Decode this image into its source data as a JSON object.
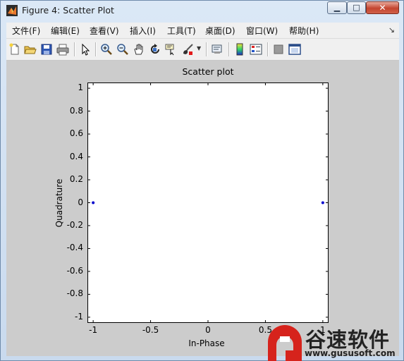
{
  "window": {
    "title": "Figure 4: Scatter Plot",
    "buttons": {
      "minimize": "▁",
      "maximize": "□",
      "close": "✕"
    }
  },
  "menu": {
    "items": [
      "文件(F)",
      "编辑(E)",
      "查看(V)",
      "插入(I)",
      "工具(T)",
      "桌面(D)",
      "窗口(W)",
      "帮助(H)"
    ],
    "overflow": "↘"
  },
  "toolbar": {
    "icons": [
      "new-icon",
      "open-icon",
      "save-icon",
      "print-icon",
      "pointer-icon",
      "zoom-in-icon",
      "zoom-out-icon",
      "pan-icon",
      "rotate-icon",
      "data-cursor-icon",
      "brush-icon",
      "link-icon",
      "colorbar-icon",
      "legend-icon",
      "hide-plot-tools-icon",
      "show-plot-tools-icon"
    ]
  },
  "chart_data": {
    "type": "scatter",
    "title": "Scatter plot",
    "xlabel": "In-Phase",
    "ylabel": "Quadrature",
    "xlim": [
      -1.05,
      1.05
    ],
    "ylim": [
      -1.05,
      1.05
    ],
    "xticks": [
      "-1",
      "-0.5",
      "0",
      "0.5",
      "1"
    ],
    "xtick_values": [
      -1,
      -0.5,
      0,
      0.5,
      1
    ],
    "yticks": [
      "1",
      "0.8",
      "0.6",
      "0.4",
      "0.2",
      "0",
      "-0.2",
      "-0.4",
      "-0.6",
      "-0.8",
      "-1"
    ],
    "ytick_values": [
      1,
      0.8,
      0.6,
      0.4,
      0.2,
      0,
      -0.2,
      -0.4,
      -0.6,
      -0.8,
      -1
    ],
    "points": [
      {
        "x": -1,
        "y": 0
      },
      {
        "x": 1,
        "y": 0
      }
    ],
    "marker_color": "#0000cc"
  },
  "watermark": {
    "brand": "谷速软件",
    "url": "www.gususoft.com",
    "logo_color": "#d6231c"
  }
}
